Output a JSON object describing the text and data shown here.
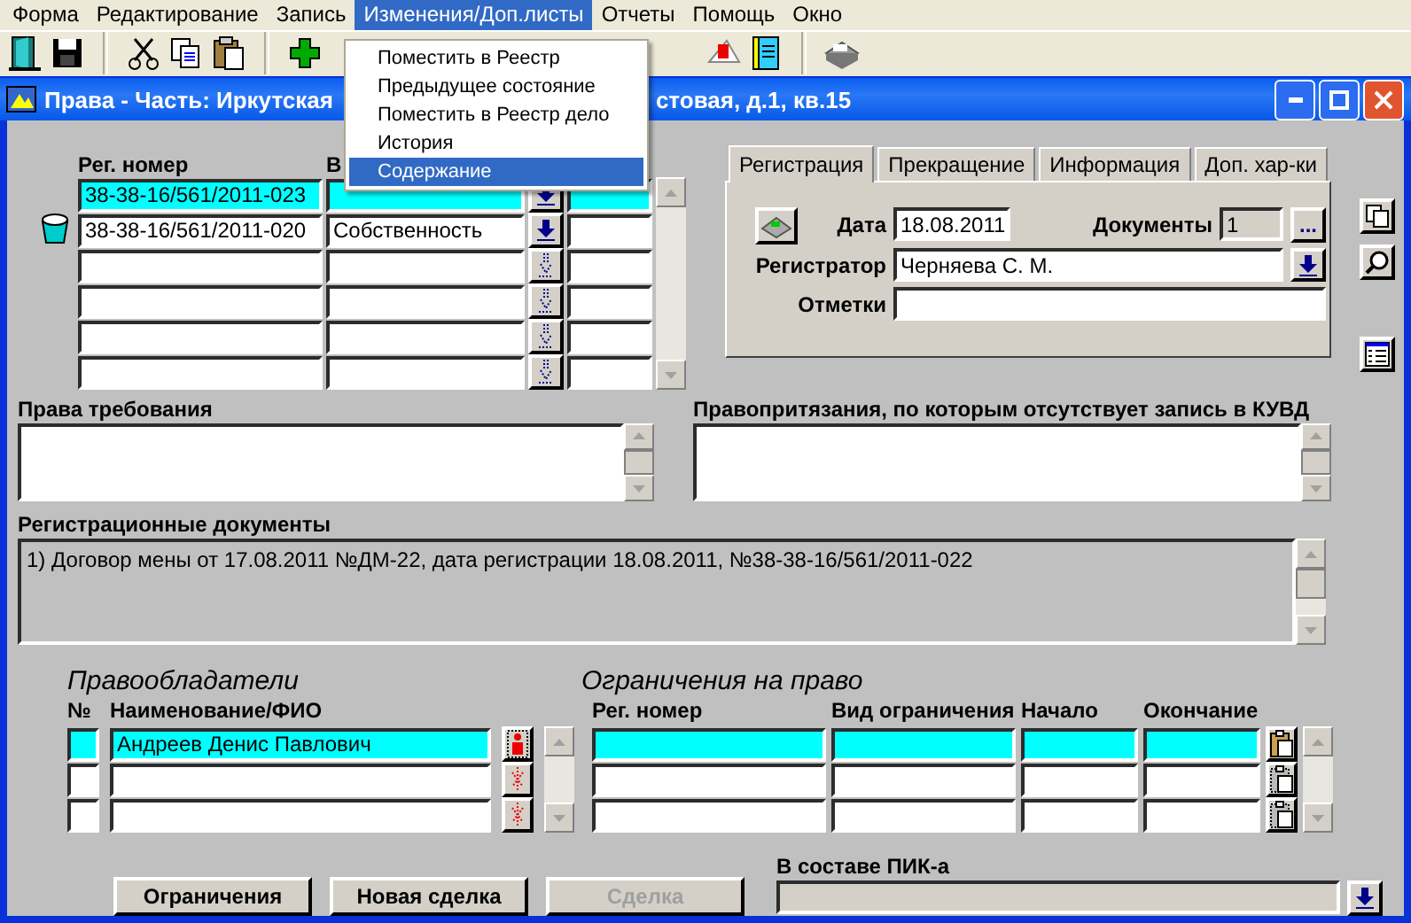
{
  "menu": [
    {
      "label": "Форма",
      "selected": false
    },
    {
      "label": "Редактирование",
      "selected": false
    },
    {
      "label": "Запись",
      "selected": false
    },
    {
      "label": "Изменения/Доп.листы",
      "selected": true
    },
    {
      "label": "Отчеты",
      "selected": false
    },
    {
      "label": "Помощь",
      "selected": false
    },
    {
      "label": "Окно",
      "selected": false
    }
  ],
  "dropdown": [
    {
      "label": "Поместить в Реестр",
      "selected": false
    },
    {
      "label": "Предыдущее состояние",
      "selected": false
    },
    {
      "label": "Поместить в Реестр дело",
      "selected": false
    },
    {
      "label": "История",
      "selected": false
    },
    {
      "label": "Содержание",
      "selected": true
    }
  ],
  "window": {
    "title_start": "Права - Часть: Иркутская",
    "title_end": "стовая, д.1, кв.15"
  },
  "rights_table": {
    "columns": [
      "Рег. номер",
      "В"
    ],
    "rows": [
      {
        "reg_number": "38-38-16/561/2011-023",
        "selected": true,
        "trash_icon": false,
        "arrow_enabled": true
      },
      {
        "reg_number": "38-38-16/561/2011-020",
        "type": "Собственность",
        "selected": false,
        "trash_icon": true,
        "arrow_enabled": true
      },
      {
        "selected": false,
        "trash_icon": false,
        "arrow_enabled": false
      },
      {
        "selected": false,
        "trash_icon": false,
        "arrow_enabled": false
      },
      {
        "selected": false,
        "trash_icon": false,
        "arrow_enabled": false
      },
      {
        "selected": false,
        "trash_icon": false,
        "arrow_enabled": false
      }
    ]
  },
  "tabs": [
    {
      "label": "Регистрация",
      "selected": true
    },
    {
      "label": "Прекращение",
      "selected": false
    },
    {
      "label": "Информация",
      "selected": false
    },
    {
      "label": "Доп. хар-ки",
      "selected": false
    }
  ],
  "registration": {
    "date_label": "Дата",
    "date": "18.08.2011",
    "documents_label": "Документы",
    "documents": "1",
    "more_button": "...",
    "registrar_label": "Регистратор",
    "registrar": "Черняева С. М.",
    "notes_label": "Отметки"
  },
  "claims": {
    "label": "Права требования"
  },
  "unrecorded_claims": {
    "label": "Правопритязания, по которым отсутствует запись в КУВД"
  },
  "reg_documents": {
    "label": "Регистрационные документы",
    "text": "1) Договор мены от 17.08.2011 №ДМ-22, дата регистрации 18.08.2011, №38-38-16/561/2011-022"
  },
  "owners": {
    "title": "Правообладатели",
    "columns": [
      "№",
      "Наименование/ФИО"
    ],
    "rows": [
      {
        "name": "Андреев Денис Павлович",
        "selected": true,
        "enabled": true
      },
      {
        "selected": false,
        "enabled": false
      },
      {
        "selected": false,
        "enabled": false
      }
    ]
  },
  "restrictions": {
    "title": "Ограничения на право",
    "columns": [
      "Рег. номер",
      "Вид ограничения",
      "Начало",
      "Окончание"
    ],
    "rows": [
      {
        "selected": true,
        "enabled": true
      },
      {
        "selected": false,
        "enabled": false
      },
      {
        "selected": false,
        "enabled": false
      }
    ]
  },
  "buttons": [
    {
      "label": "Ограничения",
      "disabled": false
    },
    {
      "label": "Новая сделка",
      "disabled": false
    },
    {
      "label": "Сделка",
      "disabled": true
    }
  ],
  "pik": {
    "label": "В составе ПИК-а"
  }
}
